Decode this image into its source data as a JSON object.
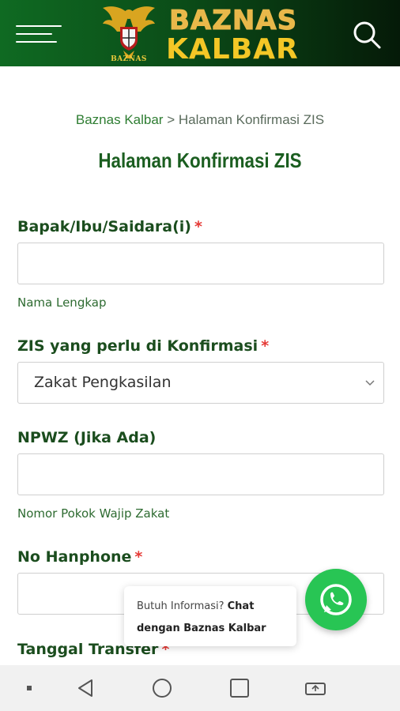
{
  "header": {
    "logo_small": "BAZNAS",
    "logo_line1": "BAZNAS",
    "logo_line2": "KALBAR",
    "icons": {
      "menu": "hamburger-icon",
      "search": "search-icon",
      "emblem": "garuda-emblem"
    }
  },
  "breadcrumb": {
    "home": "Baznas Kalbar",
    "separator": ">",
    "current": "Halaman Konfirmasi ZIS"
  },
  "page_title": "Halaman Konfirmasi ZIS",
  "form": {
    "name": {
      "label": "Bapak/Ibu/Saidara(i)",
      "required": "*",
      "value": "",
      "help": "Nama Lengkap"
    },
    "zis": {
      "label": "ZIS yang perlu di Konfirmasi",
      "required": "*",
      "selected": "Zakat Pengkasilan"
    },
    "npwz": {
      "label": "NPWZ (Jika Ada)",
      "value": "",
      "help": "Nomor Pokok Wajip Zakat"
    },
    "phone": {
      "label": "No Hanphone",
      "required": "*",
      "value": ""
    },
    "transfer_date": {
      "label": "Tanggal Transfer",
      "required": "*"
    }
  },
  "chat": {
    "text_prefix": "Butuh Informasi?",
    "text_bold": "Chat dengan Baznas Kalbar",
    "icon": "whatsapp-icon",
    "color": "#28c554"
  },
  "navbar": {
    "icons": [
      "menu-dot-icon",
      "back-icon",
      "home-icon",
      "recents-icon",
      "screen-rotate-icon"
    ]
  },
  "colors": {
    "brand_green": "#1b5e20",
    "header_gradient_start": "#0f6a22",
    "header_gradient_end": "#051a08",
    "logo_gold": "#f4c726",
    "required_red": "#e53935"
  }
}
